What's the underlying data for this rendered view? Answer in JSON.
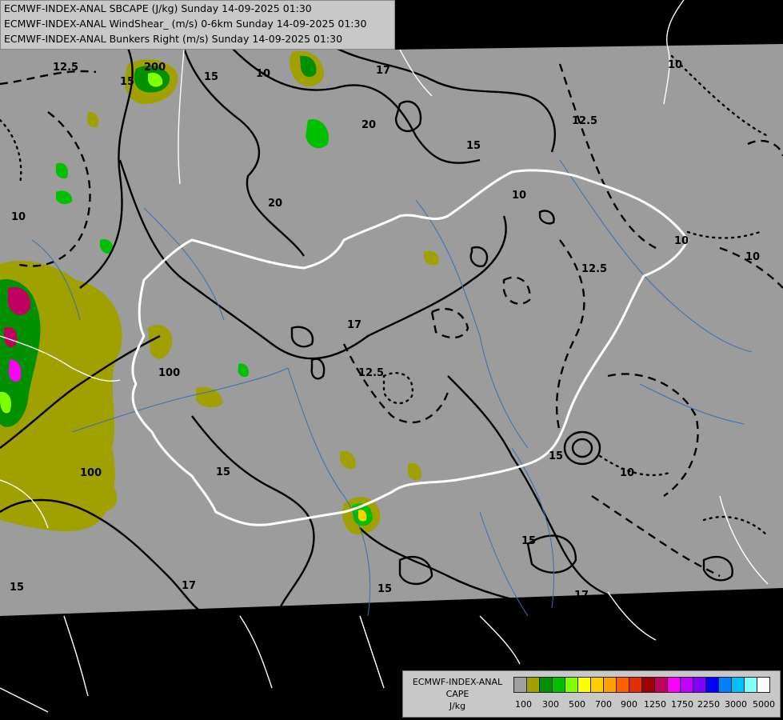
{
  "header": {
    "line1": "ECMWF-INDEX-ANAL SBCAPE (J/kg) Sunday 14-09-2025 01:30",
    "line2": "ECMWF-INDEX-ANAL WindShear_ (m/s) 0-6km Sunday 14-09-2025 01:30",
    "line3": "ECMWF-INDEX-ANAL Bunkers Right (m/s) Sunday 14-09-2025 01:30"
  },
  "legend": {
    "title1": "ECMWF-INDEX-ANAL",
    "title2": "CAPE",
    "title3": "J/kg",
    "colors": [
      "#a0a0a0",
      "#a0a000",
      "#009000",
      "#00c000",
      "#80ff00",
      "#ffff00",
      "#ffd000",
      "#ffa000",
      "#ff6000",
      "#e03000",
      "#a00000",
      "#c00060",
      "#ff00ff",
      "#c000ff",
      "#8000ff",
      "#0000ff",
      "#0080ff",
      "#00c0ff",
      "#80ffff",
      "#ffffff"
    ],
    "ticks": [
      "100",
      "300",
      "500",
      "700",
      "900",
      "1250",
      "1750",
      "2250",
      "3000",
      "5000"
    ]
  },
  "contour_labels": [
    "12.5",
    "200",
    "15",
    "15",
    "10",
    "17",
    "20",
    "15",
    "12.5",
    "10",
    "20",
    "10",
    "10",
    "10",
    "12.5",
    "10",
    "17",
    "100",
    "100",
    "12.5",
    "15",
    "15",
    "10",
    "15",
    "17",
    "15",
    "17",
    "15"
  ]
}
